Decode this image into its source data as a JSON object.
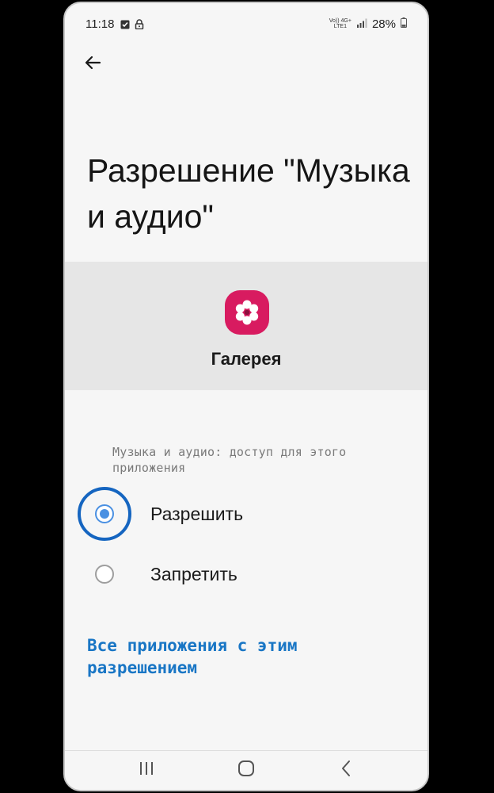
{
  "status_bar": {
    "time": "11:18",
    "network_label_top": "Vo)) 4G+",
    "network_label_bottom": "LTE1",
    "battery": "28%"
  },
  "header": {
    "title": "Разрешение \"Музыка и аудио\""
  },
  "app": {
    "name": "Галерея",
    "icon": "gallery-flower-icon",
    "icon_color": "#d81b60"
  },
  "permission": {
    "caption": "Музыка и аудио: доступ для этого приложения",
    "options": [
      {
        "label": "Разрешить",
        "selected": true
      },
      {
        "label": "Запретить",
        "selected": false
      }
    ]
  },
  "link": {
    "label": "Все приложения с этим разрешением"
  },
  "nav": {
    "recents_icon": "recents-icon",
    "home_icon": "home-icon",
    "back_icon": "back-icon"
  },
  "colors": {
    "accent": "#1976c5",
    "radio_selected": "#4a90e2",
    "highlight_ring": "#1565c0"
  }
}
